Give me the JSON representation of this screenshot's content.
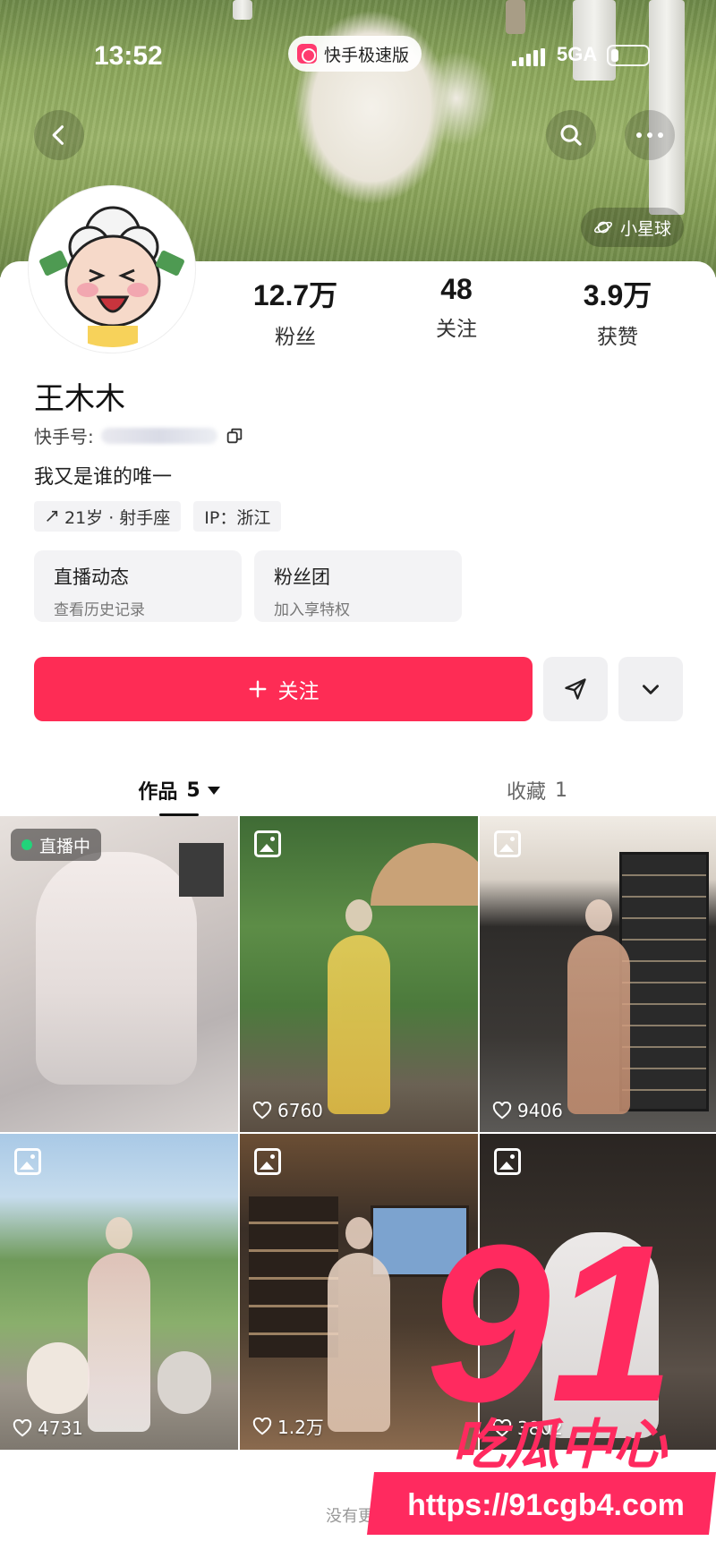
{
  "status_bar": {
    "time": "13:52",
    "network": "5GA",
    "app_name": "快手极速版"
  },
  "header": {
    "back_icon": "chevron-left-icon",
    "search_icon": "search-icon",
    "more_icon": "more-dots-icon",
    "planet_label": "小星球"
  },
  "profile": {
    "stats": [
      {
        "value": "12.7万",
        "label": "粉丝"
      },
      {
        "value": "48",
        "label": "关注"
      },
      {
        "value": "3.9万",
        "label": "获赞"
      }
    ],
    "name": "王木木",
    "kid_label": "快手号:",
    "bio": "我又是谁的唯一",
    "tags": [
      "21岁 · 射手座",
      "IP：浙江"
    ],
    "entries": [
      {
        "title": "直播动态",
        "sub": "查看历史记录"
      },
      {
        "title": "粉丝团",
        "sub": "加入享特权"
      }
    ],
    "follow_label": "关注"
  },
  "tabs": {
    "works_label": "作品",
    "works_count": "5",
    "collect_label": "收藏",
    "collect_count": "1"
  },
  "grid": [
    {
      "badge": "直播中",
      "likes": ""
    },
    {
      "likes": "6760"
    },
    {
      "likes": "9406"
    },
    {
      "likes": "4731"
    },
    {
      "likes": "1.2万"
    },
    {
      "likes": "3802"
    }
  ],
  "footer_note": "没有更多",
  "watermark": {
    "number": "91",
    "slogan": "吃瓜中心",
    "url": "https://91cgb4.com"
  },
  "colors": {
    "accent": "#fe2c55",
    "live": "#22d37a"
  }
}
